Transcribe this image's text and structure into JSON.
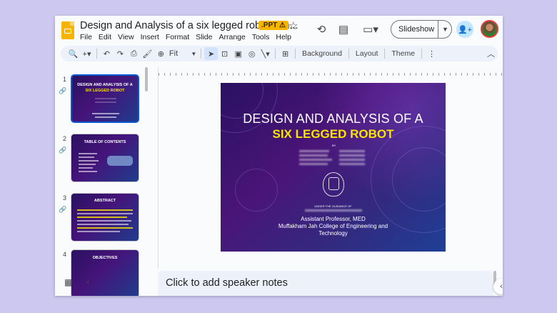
{
  "header": {
    "title": "Design and Analysis of a six legged robot - fin...",
    "badge": ".PPT",
    "menu": [
      "File",
      "Edit",
      "View",
      "Insert",
      "Format",
      "Slide",
      "Arrange",
      "Tools",
      "Help"
    ],
    "slideshow_label": "Slideshow"
  },
  "toolbar": {
    "zoom": "Fit",
    "background_label": "Background",
    "layout_label": "Layout",
    "theme_label": "Theme"
  },
  "filmstrip": [
    {
      "number": "1",
      "title": "DESIGN AND ANALYSIS OF A",
      "subtitle": "SIX LEGGED ROBOT",
      "selected": true
    },
    {
      "number": "2",
      "title": "TABLE OF CONTENTS",
      "subtitle": "",
      "selected": false
    },
    {
      "number": "3",
      "title": "ABSTRACT",
      "subtitle": "",
      "selected": false
    },
    {
      "number": "4",
      "title": "OBJECTIVES",
      "subtitle": "",
      "selected": false
    }
  ],
  "slide": {
    "title": "DESIGN AND ANALYSIS OF A",
    "subtitle": "SIX LEGGED ROBOT",
    "by": "BY",
    "under_guidance": "UNDER THE GUIDANCE OF",
    "guide_title": "Assistant Professor, MED",
    "college_line1": "Muffakham Jah College of Engineering and",
    "college_line2": "Technology"
  },
  "notes": {
    "placeholder": "Click to add speaker notes"
  },
  "colors": {
    "accent": "#0b57d0",
    "slide_yellow": "#f9e300",
    "background": "#cdc8f0"
  }
}
